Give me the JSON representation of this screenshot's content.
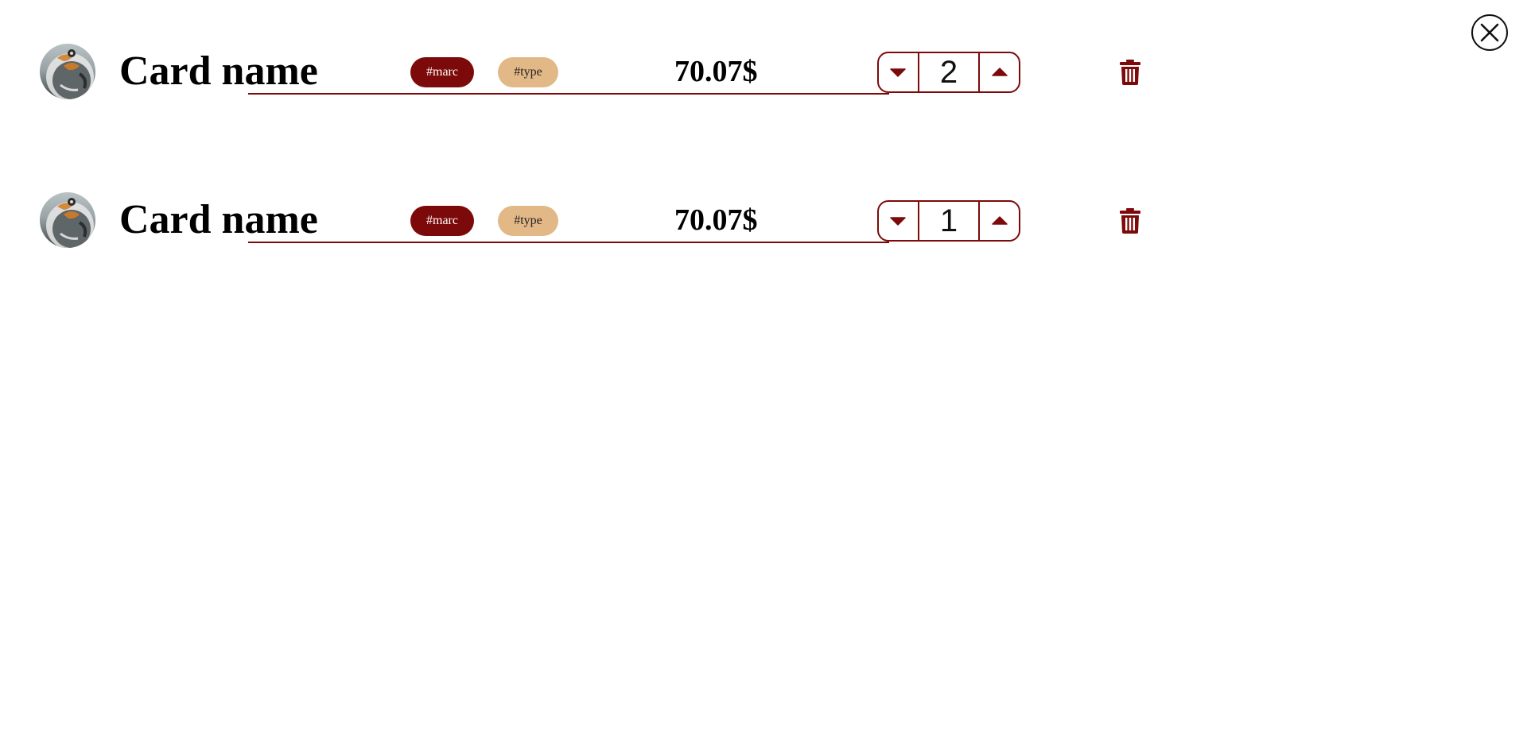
{
  "header": {
    "close_icon": "close-circle-icon"
  },
  "colors": {
    "accent": "#7d0a0a",
    "tag_marc_bg": "#7d0a0a",
    "tag_type_bg": "#e2b887"
  },
  "cart": {
    "items": [
      {
        "name": "Card name",
        "tag_marc": "#marc",
        "tag_type": "#type",
        "price": "70.07$",
        "quantity": "2",
        "decrement_icon": "caret-down-icon",
        "increment_icon": "caret-up-icon",
        "delete_icon": "trash-icon"
      },
      {
        "name": "Card name",
        "tag_marc": "#marc",
        "tag_type": "#type",
        "price": "70.07$",
        "quantity": "1",
        "decrement_icon": "caret-down-icon",
        "increment_icon": "caret-up-icon",
        "delete_icon": "trash-icon"
      }
    ]
  }
}
